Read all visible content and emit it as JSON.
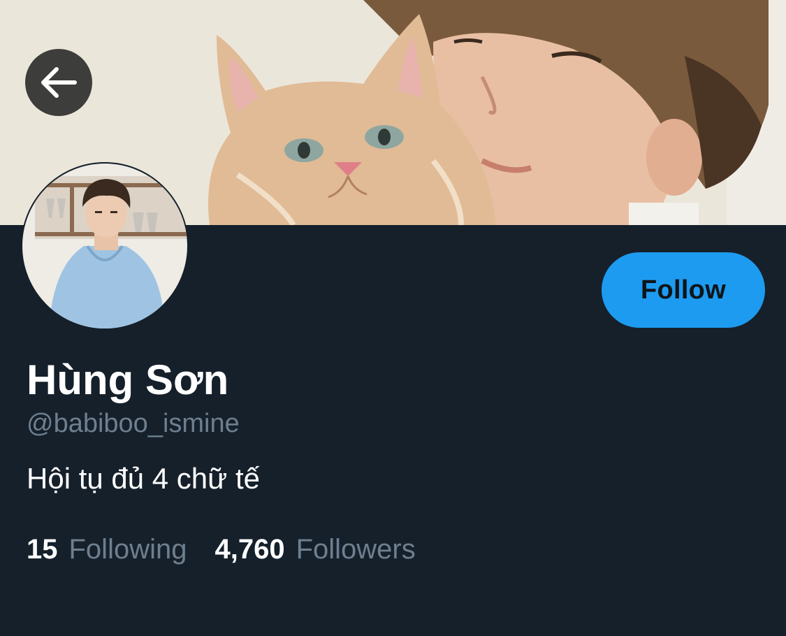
{
  "header": {
    "back_icon": "arrow-left-icon",
    "banner": "cover-photo"
  },
  "profile": {
    "avatar": "profile-photo",
    "display_name": "Hùng Sơn",
    "handle": "@babiboo_ismine",
    "bio": "Hội tụ đủ 4 chữ tế"
  },
  "actions": {
    "follow_label": "Follow"
  },
  "stats": {
    "following_count": "15",
    "following_label": "Following",
    "followers_count": "4,760",
    "followers_label": "Followers"
  },
  "colors": {
    "background": "#15202b",
    "accent": "#1d9bf0",
    "secondary_text": "#6e7f8f",
    "primary_text": "#ffffff"
  }
}
